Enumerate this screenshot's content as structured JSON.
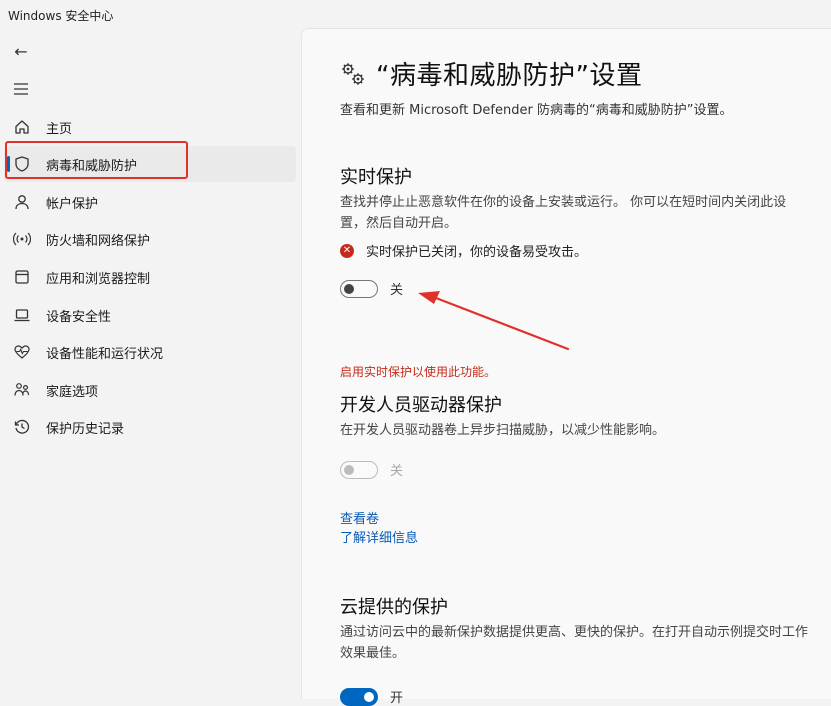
{
  "app": {
    "title": "Windows 安全中心"
  },
  "nav": {
    "back": "←",
    "items": [
      {
        "label": "主页",
        "icon": "home-icon"
      },
      {
        "label": "病毒和威胁防护",
        "icon": "shield-icon",
        "active": true
      },
      {
        "label": "帐户保护",
        "icon": "person-icon"
      },
      {
        "label": "防火墙和网络保护",
        "icon": "wireless-icon"
      },
      {
        "label": "应用和浏览器控制",
        "icon": "app-window-icon"
      },
      {
        "label": "设备安全性",
        "icon": "laptop-icon"
      },
      {
        "label": "设备性能和运行状况",
        "icon": "heart-pulse-icon"
      },
      {
        "label": "家庭选项",
        "icon": "family-icon"
      },
      {
        "label": "保护历史记录",
        "icon": "history-icon"
      }
    ]
  },
  "page": {
    "title": "“病毒和威胁防护”设置",
    "description": "查看和更新 Microsoft Defender 防病毒的“病毒和威胁防护”设置。"
  },
  "realtime": {
    "title": "实时保护",
    "description": "查找并停止止恶意软件在你的设备上安装或运行。 你可以在短时间内关闭此设置，然后自动开启。",
    "alert": "实时保护已关闭，你的设备易受攻击。",
    "toggle_label": "关",
    "toggle_on": false
  },
  "error_note": "启用实时保护以使用此功能。",
  "devdrive": {
    "title": "开发人员驱动器保护",
    "description": "在开发人员驱动器卷上异步扫描威胁，以减少性能影响。",
    "toggle_label": "关",
    "toggle_on": false,
    "link_volumes": "查看卷",
    "link_more": "了解详细信息"
  },
  "cloud": {
    "title": "云提供的保护",
    "description": "通过访问云中的最新保护数据提供更高、更快的保护。在打开自动示例提交时工作效果最佳。",
    "toggle_label": "开",
    "toggle_on": true
  },
  "colors": {
    "accent": "#0067c0",
    "error": "#c42b1c",
    "annotation": "#e0312b"
  }
}
